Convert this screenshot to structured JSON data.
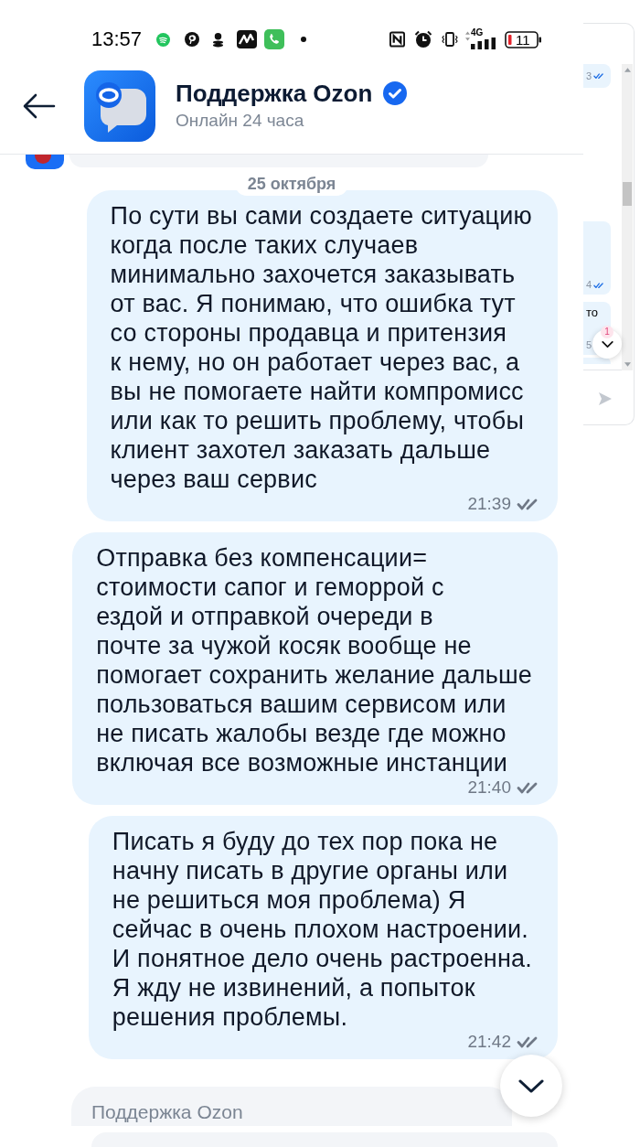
{
  "status_bar": {
    "time": "13:57",
    "network": "4G",
    "battery": "11"
  },
  "header": {
    "title": "Поддержка Ozon",
    "verified": true,
    "subtitle": "Онлайн 24 часа"
  },
  "messages": [
    {
      "kind": "date",
      "text": "25 октября"
    },
    {
      "kind": "outgoing",
      "text": "По сути вы сами создаете ситуацию\nкогда после таких случаев\nминимально захочется заказывать\nот вас. Я понимаю, что ошибка тут\nсо стороны продавца и притензия\nк нему, но он работает через вас, а\nвы не помогаете найти компромисс\nили как то решить проблему, чтобы\nклиент захотел заказать дальше\nчерез ваш сервис",
      "time": "21:39",
      "read": false
    },
    {
      "kind": "outgoing",
      "text": "Отправка без компенсации=\nстоимости сапог и геморрой с\nездой и отправкой очереди в\nпочте за чужой косяк вообще не\nпомогает сохранить желание дальше\nпользоваться вашим сервисом или\nне писать жалобы везде где можно\nвключая все возможные инстанции",
      "time": "21:40",
      "read": false
    },
    {
      "kind": "outgoing",
      "text": "Писать я буду до тех пор пока не\nначну писать в другие органы или\nне решиться моя проблема) Я\nсейчас в очень плохом настроении.\nИ понятное дело очень растроенна.\nЯ жду не извинений, а попыток\nрешения проблемы.",
      "time": "21:42",
      "read": false
    },
    {
      "kind": "incoming",
      "sender": "Поддержка Ozon"
    }
  ],
  "background_chat": {
    "messages": [
      {
        "time": "3",
        "read": true
      },
      {
        "time": "4",
        "read": true
      },
      {
        "text": "то",
        "time": "5"
      }
    ],
    "unread_badge": "1"
  }
}
